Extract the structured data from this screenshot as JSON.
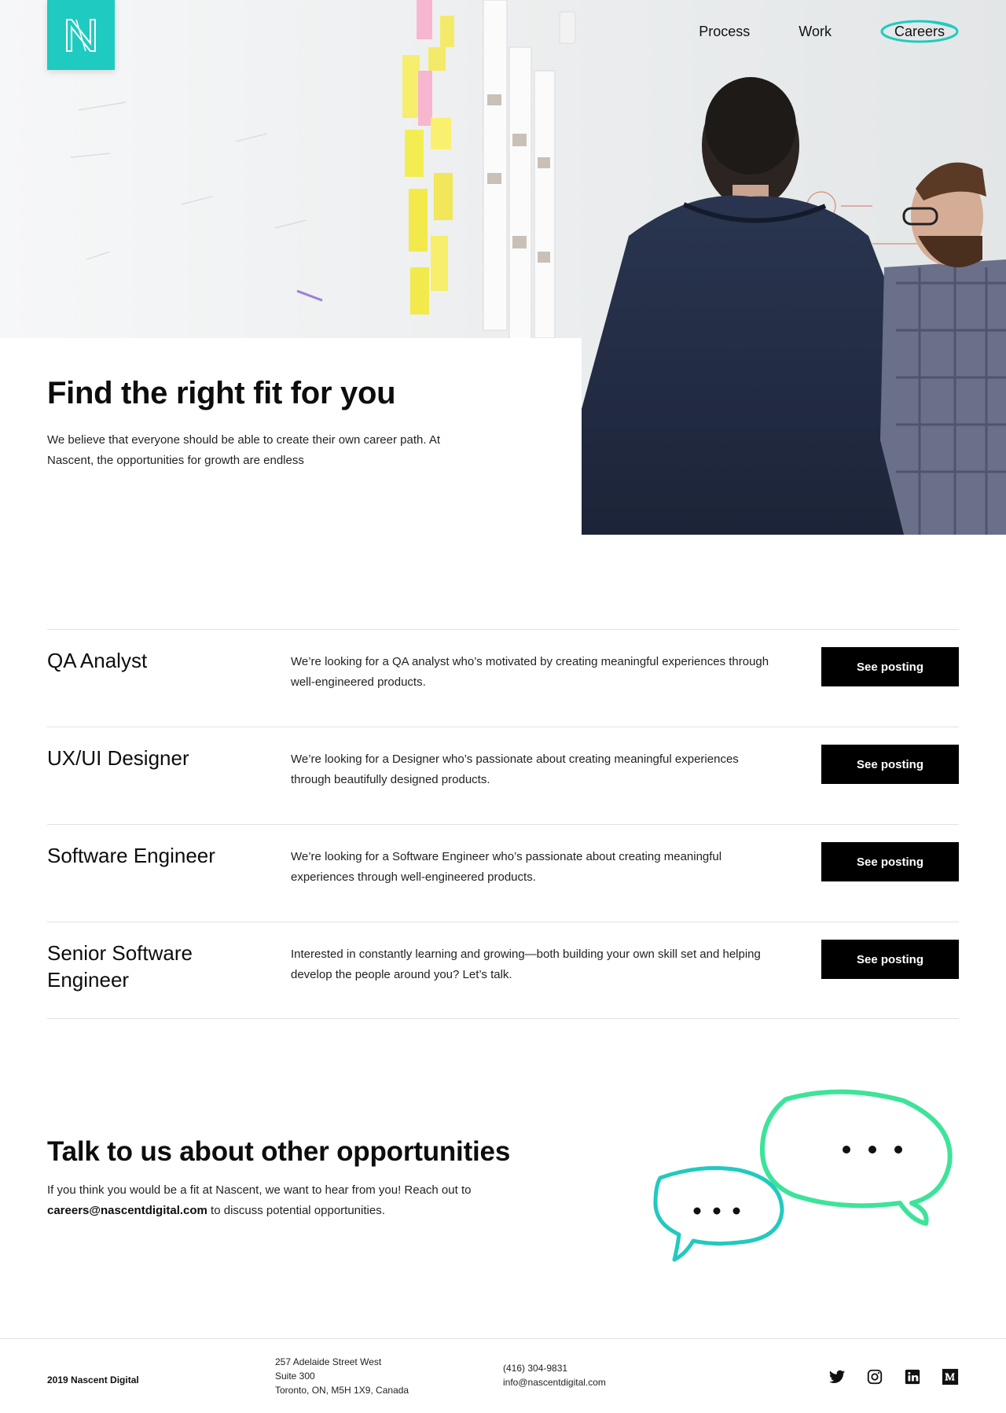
{
  "nav": {
    "logo_letter": "N",
    "items": [
      {
        "label": "Process"
      },
      {
        "label": "Work"
      },
      {
        "label": "Careers"
      }
    ]
  },
  "hero": {
    "title": "Find the right fit for you",
    "body": "We believe that everyone should be able to create their own career path. At Nascent, the opportunities for growth are endless"
  },
  "jobs": [
    {
      "title": "QA Analyst",
      "description": "We’re looking for a QA analyst who’s motivated by creating meaningful experiences through well-engineered products.",
      "button": "See posting"
    },
    {
      "title": "UX/UI Designer",
      "description": "We’re looking for a Designer who’s passionate about creating meaningful experiences through beautifully designed products.",
      "button": "See posting"
    },
    {
      "title": "Software Engineer",
      "description": "We’re looking for a Software Engineer who’s passionate about creating meaningful experiences through well-engineered products.",
      "button": "See posting"
    },
    {
      "title": "Senior Software Engineer",
      "description": "Interested in constantly learning and growing—both building your own skill set and helping develop the people around you? Let’s talk.",
      "button": "See posting"
    }
  ],
  "contact": {
    "title": "Talk to us about other opportunities",
    "body_before": "If you think you would be a fit at Nascent, we want to hear from you! Reach out to ",
    "email": "careers@nascentdigital.com",
    "body_after": " to discuss potential opportunities."
  },
  "footer": {
    "copyright": "2019 Nascent Digital",
    "address_line1": "257 Adelaide Street West",
    "address_line2": "Suite 300",
    "address_line3": "Toronto, ON, M5H 1X9, Canada",
    "phone": "(416) 304-9831",
    "email": "info@nascentdigital.com",
    "social_icons": [
      "twitter-icon",
      "instagram-icon",
      "linkedin-icon",
      "medium-icon"
    ]
  },
  "colors": {
    "accent": "#1fcbc0",
    "bubble_green": "#3ee39a",
    "bubble_teal": "#22c9bf",
    "button": "#000000"
  }
}
